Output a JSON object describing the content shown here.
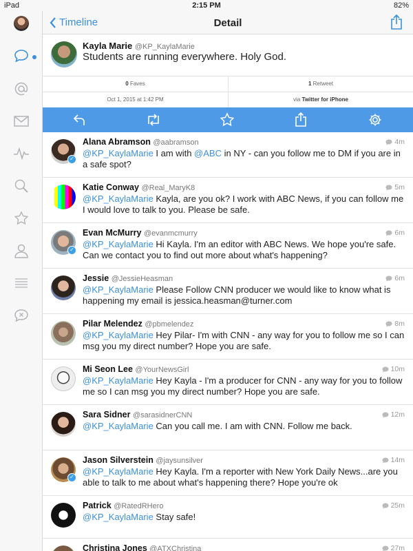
{
  "status_bar": {
    "device": "iPad",
    "time": "2:15 PM",
    "battery": "82%"
  },
  "header": {
    "back_label": "Timeline",
    "title": "Detail"
  },
  "sidebar": {
    "items": [
      "speech-bubble",
      "at-sign",
      "mail",
      "activity",
      "search",
      "star",
      "profile",
      "list",
      "muted-chat"
    ]
  },
  "detail": {
    "name": "Kayla Marie",
    "handle": "@KP_KaylaMarie",
    "text": "Students are running everywhere. Holy God.",
    "faves_count": "0",
    "faves_label": "Faves",
    "retweets_count": "1",
    "retweets_label": "Retweet",
    "timestamp": "Oct 1, 2015 at 1:42 PM",
    "via_prefix": "via",
    "via_app": "Twitter for iPhone"
  },
  "replies": [
    {
      "name": "Alana Abramson",
      "handle": "@aabramson",
      "time": "4m",
      "mention": "@KP_KaylaMarie",
      "mention2": "@ABC",
      "text_a": " I am with ",
      "text_b": " in NY - can you follow me to DM if you are in a safe spot?",
      "verified": true
    },
    {
      "name": "Katie Conway",
      "handle": "@Real_MaryK8",
      "time": "5m",
      "mention": "@KP_KaylaMarie",
      "text": " Kayla, are you ok? I work with ABC News, if you can follow me I would love to talk to you. Please be safe.",
      "verified": false
    },
    {
      "name": "Evan McMurry",
      "handle": "@evanmcmurry",
      "time": "6m",
      "mention": "@KP_KaylaMarie",
      "text": " Hi Kayla. I'm an editor with ABC News. We hope you're safe. Can we contact you to find out more about what's happening?",
      "verified": true
    },
    {
      "name": "Jessie",
      "handle": "@JessieHeasman",
      "time": "6m",
      "mention": "@KP_KaylaMarie",
      "text": " Please Follow CNN producer we would like to know what is happening my email is jessica.heasman@turner.com",
      "verified": false
    },
    {
      "name": "Pilar Melendez",
      "handle": "@pbmelendez",
      "time": "8m",
      "mention": "@KP_KaylaMarie",
      "text": " Hey Pilar- I'm with CNN - any way for you to follow me so I can msg you my direct number? Hope you are safe.",
      "verified": false
    },
    {
      "name": "Mi Seon Lee",
      "handle": "@YourNewsGirl",
      "time": "10m",
      "mention": "@KP_KaylaMarie",
      "text": " Hey Kayla - I'm a producer for CNN - any way for you to follow me so I can msg you my direct number? Hope you are safe.",
      "verified": false
    },
    {
      "name": "Sara Sidner",
      "handle": "@sarasidnerCNN",
      "time": "12m",
      "mention": "@KP_KaylaMarie",
      "text": " Can you call me. I am with CNN. Follow me back.",
      "verified": false
    },
    {
      "name": "Jason Silverstein",
      "handle": "@jaysunsilver",
      "time": "14m",
      "mention": "@KP_KaylaMarie",
      "text": " Hey Kayla. I'm a reporter with New York Daily News...are you able to talk to me about what's happening there? Hope you're ok",
      "verified": true
    },
    {
      "name": "Patrick",
      "handle": "@RatedRHero",
      "time": "25m",
      "mention": "@KP_KaylaMarie",
      "text": " Stay safe!",
      "verified": false
    },
    {
      "name": "Christina Jones",
      "handle": "@ATXChristina",
      "time": "27m",
      "mention": "",
      "text": "",
      "verified": false
    }
  ],
  "colors": {
    "accent": "#3b8fe0",
    "action_bar": "#4e9ae6",
    "verified": "#3da0e6"
  }
}
